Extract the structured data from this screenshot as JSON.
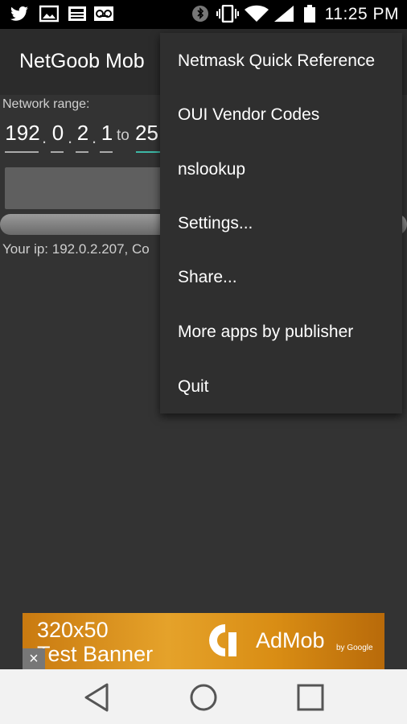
{
  "status_bar": {
    "time": "11:25 PM",
    "icons": [
      "twitter-icon",
      "image-icon",
      "news-icon",
      "voicemail-icon",
      "bluetooth-icon",
      "vibrate-icon",
      "wifi-icon",
      "signal-icon",
      "battery-icon"
    ]
  },
  "app_bar": {
    "title": "NetGoob Mob"
  },
  "main": {
    "network_range_label": "Network range:",
    "from_octets": [
      "192",
      "0",
      "2",
      "1"
    ],
    "to_label": "to",
    "to_first_octet_partial": "25",
    "your_ip_text": "Your ip: 192.0.2.207, Co"
  },
  "overflow_menu": {
    "items": [
      {
        "label": "Netmask Quick Reference"
      },
      {
        "label": "OUI Vendor Codes"
      },
      {
        "label": "nslookup"
      },
      {
        "label": "Settings..."
      },
      {
        "label": "Share..."
      },
      {
        "label": "More apps by publisher"
      },
      {
        "label": "Quit"
      }
    ]
  },
  "ad_banner": {
    "line1": "320x50",
    "line2": "Test Banner",
    "brand": "AdMob",
    "by_google": "by Google",
    "close_glyph": "×"
  },
  "nav_bar": {
    "buttons": [
      "back-icon",
      "home-icon",
      "recents-icon"
    ]
  },
  "colors": {
    "accent": "#3db8a6",
    "background": "#333333",
    "menu_bg": "#2f2f2f"
  }
}
